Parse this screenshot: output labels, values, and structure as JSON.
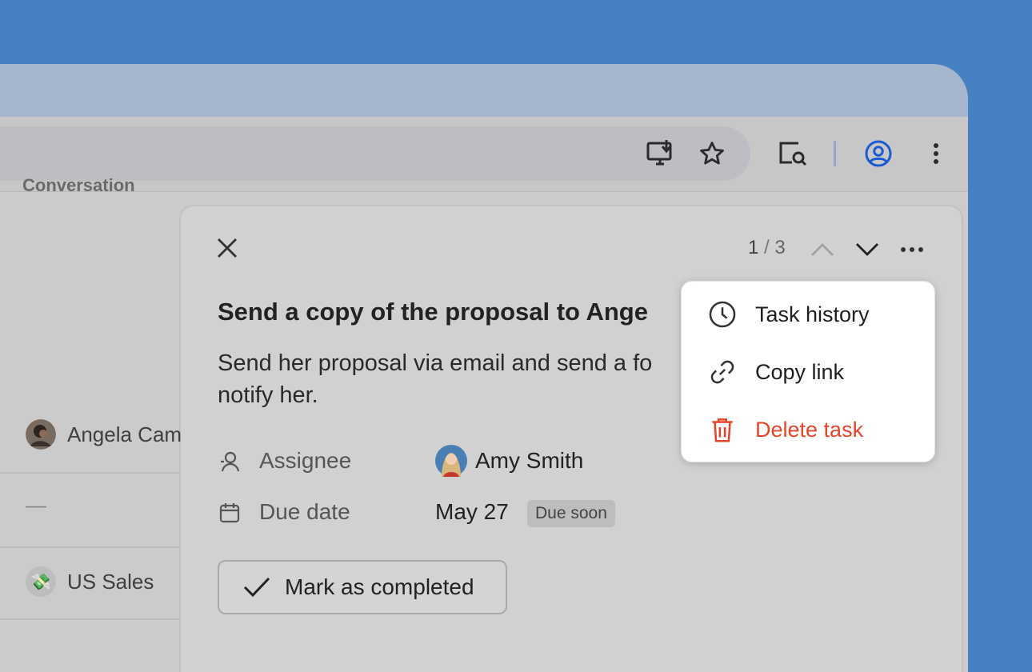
{
  "toolbar": {
    "icons": [
      "install-app-icon",
      "bookmark-star-icon",
      "search-tabs-icon",
      "profile-icon",
      "more-vert-icon"
    ],
    "accent_color": "#1a5bd4"
  },
  "left_panel": {
    "column_header": "Conversation",
    "rows": [
      {
        "label": "Angela Cam",
        "avatar": "person-photo"
      },
      {
        "label": "—"
      },
      {
        "label": "US Sales",
        "avatar": "money-emoji"
      }
    ]
  },
  "task": {
    "pager": {
      "current": "1",
      "sep": " / ",
      "total": "3"
    },
    "title": "Send a copy of the proposal to Ange",
    "description": "Send her proposal via email and send a fo notify her.",
    "assignee_label": "Assignee",
    "assignee_name": "Amy Smith",
    "due_label": "Due date",
    "due_value": "May 27",
    "due_badge": "Due soon",
    "complete_label": "Mark as completed"
  },
  "menu": {
    "items": [
      {
        "label": "Task history",
        "icon": "clock-icon"
      },
      {
        "label": "Copy link",
        "icon": "link-icon"
      },
      {
        "label": "Delete task",
        "icon": "trash-icon",
        "color": "#e5452b"
      }
    ]
  }
}
